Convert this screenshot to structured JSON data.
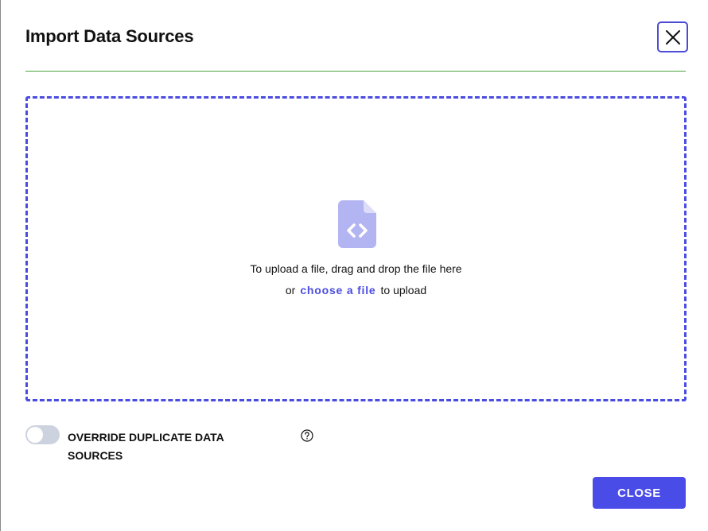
{
  "dialog": {
    "title": "Import Data Sources",
    "close_icon": "close-icon"
  },
  "dropzone": {
    "icon": "file-code-icon",
    "instruction_line1": "To upload a file, drag and drop the file here",
    "prefix": "or",
    "link_label": "choose a file",
    "suffix": "to upload"
  },
  "options": {
    "override_label": "OVERRIDE DUPLICATE DATA SOURCES",
    "override_enabled": false,
    "help_icon": "question-circle-icon"
  },
  "footer": {
    "close_label": "CLOSE"
  },
  "colors": {
    "accent": "#4a4ce8",
    "divider": "#4aa43f",
    "icon_tint": "#b3b4f2",
    "toggle_off": "#cdd3de"
  }
}
